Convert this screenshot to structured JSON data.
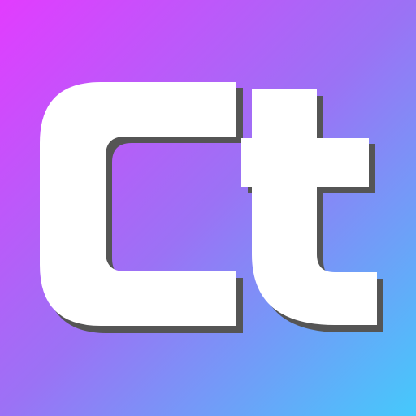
{
  "icon": {
    "text": "Ct",
    "colors": {
      "gradient_start": "#e23cff",
      "gradient_mid": "#9b72f5",
      "gradient_end": "#45c9fb",
      "glyph_fill": "#ffffff",
      "glyph_shadow": "#555555"
    }
  }
}
